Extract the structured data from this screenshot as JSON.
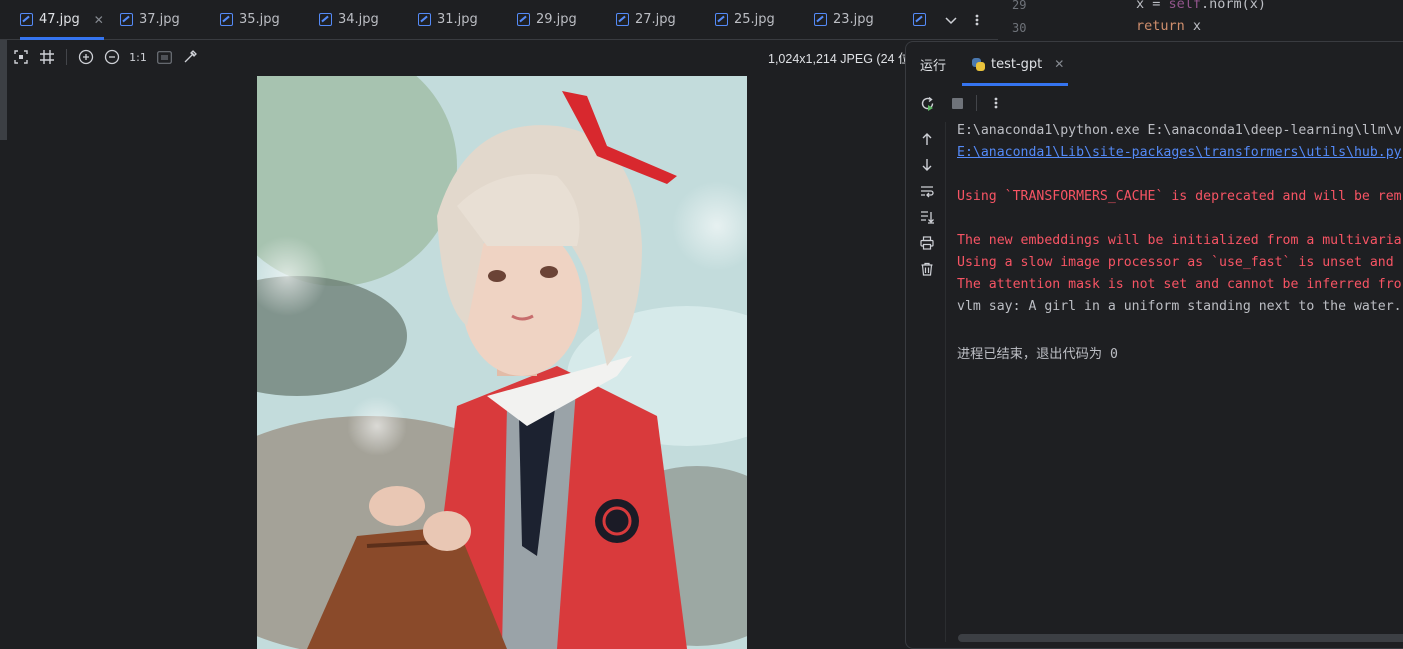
{
  "tabs": [
    {
      "label": "47.jpg",
      "active": true
    },
    {
      "label": "37.jpg"
    },
    {
      "label": "35.jpg"
    },
    {
      "label": "34.jpg"
    },
    {
      "label": "31.jpg"
    },
    {
      "label": "29.jpg"
    },
    {
      "label": "27.jpg"
    },
    {
      "label": "25.jpg"
    },
    {
      "label": "23.jpg"
    }
  ],
  "image_toolbar": {
    "zoom_label": "1:1",
    "info": "1,024x1,214 JPEG (24 位"
  },
  "editor": {
    "lines": [
      {
        "num": "29",
        "pre": "x = ",
        "kw": "self",
        "post": ".norm(x)"
      },
      {
        "num": "30",
        "ret": "return",
        "post": " x"
      }
    ]
  },
  "run_panel": {
    "title": "运行",
    "tab_label": "test-gpt",
    "console": [
      {
        "type": "normal",
        "text": "E:\\anaconda1\\python.exe E:\\anaconda1\\deep-learning\\llm\\v"
      },
      {
        "type": "link",
        "text": "E:\\anaconda1\\Lib\\site-packages\\transformers\\utils\\hub.py"
      },
      {
        "type": "blank",
        "text": ""
      },
      {
        "type": "err",
        "text": "Using `TRANSFORMERS_CACHE` is deprecated and will be rem"
      },
      {
        "type": "blank",
        "text": ""
      },
      {
        "type": "err",
        "text": "The new embeddings will be initialized from a multivaria"
      },
      {
        "type": "err",
        "text": "Using a slow image processor as `use_fast` is unset and"
      },
      {
        "type": "err",
        "text": "The attention mask is not set and cannot be inferred fro"
      },
      {
        "type": "normal",
        "text": "vlm say: A girl in a uniform standing next to the water."
      },
      {
        "type": "blank",
        "text": ""
      },
      {
        "type": "normal",
        "text": "进程已结束，退出代码为 0"
      }
    ]
  }
}
